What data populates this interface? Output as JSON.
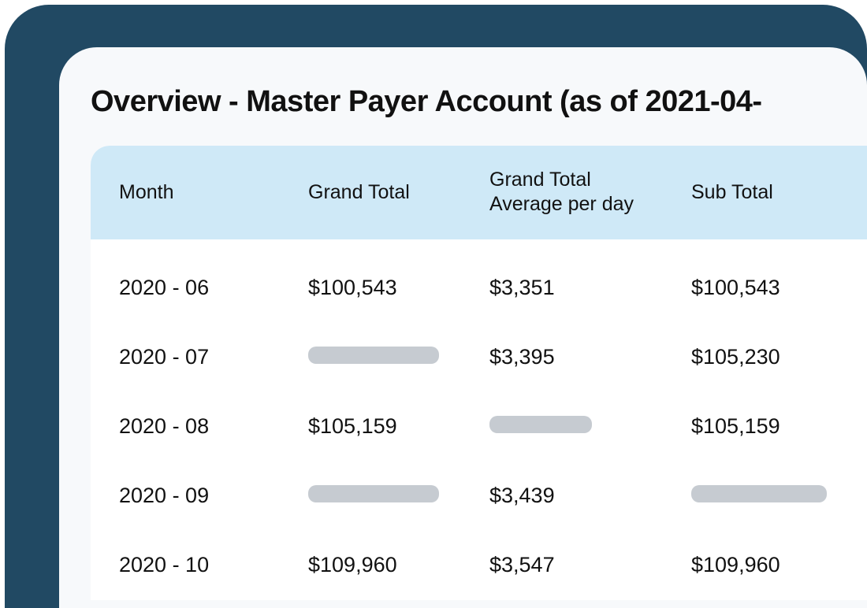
{
  "title": "Overview - Master Payer Account (as of 2021-04-",
  "table": {
    "headers": {
      "month": "Month",
      "grand_total": "Grand Total",
      "avg_per_day": "Grand Total\nAverage per day",
      "sub_total": "Sub Total"
    },
    "rows": [
      {
        "month": "2020 - 06",
        "grand_total": "$100,543",
        "avg_per_day": "$3,351",
        "sub_total": "$100,543"
      },
      {
        "month": "2020 - 07",
        "grand_total": null,
        "avg_per_day": "$3,395",
        "sub_total": "$105,230"
      },
      {
        "month": "2020 - 08",
        "grand_total": "$105,159",
        "avg_per_day": null,
        "sub_total": "$105,159"
      },
      {
        "month": "2020 - 09",
        "grand_total": null,
        "avg_per_day": "$3,439",
        "sub_total": null
      },
      {
        "month": "2020 - 10",
        "grand_total": "$109,960",
        "avg_per_day": "$3,547",
        "sub_total": "$109,960"
      }
    ]
  }
}
